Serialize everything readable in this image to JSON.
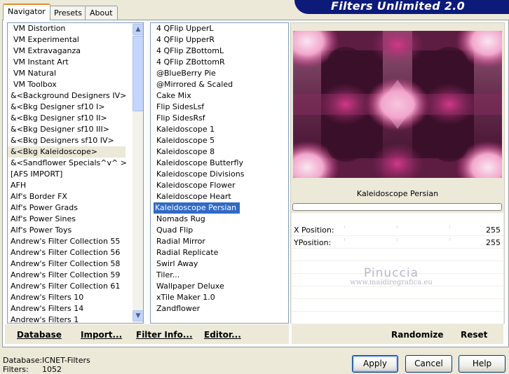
{
  "brand": {
    "title": "Filters Unlimited 2.0",
    "color": "#0c1a7a"
  },
  "tabs": [
    {
      "label": "Navigator",
      "active": true
    },
    {
      "label": "Presets",
      "active": false
    },
    {
      "label": "About",
      "active": false
    }
  ],
  "categories": {
    "items": [
      "VM Distortion",
      "VM Experimental",
      "VM Extravaganza",
      "VM Instant Art",
      "VM Natural",
      "VM Toolbox",
      "&<Background Designers IV>",
      "&<Bkg Designer sf10 I>",
      "&<Bkg Designer sf10 II>",
      "&<Bkg Designer sf10 III>",
      "&<Bkg Designers sf10 IV>",
      "&<Bkg Kaleidoscope>",
      "&<Sandflower Specials^v^ >",
      "[AFS IMPORT]",
      "AFH",
      "Alf's Border FX",
      "Alf's Power Grads",
      "Alf's Power Sines",
      "Alf's Power Toys",
      "Andrew's Filter Collection 55",
      "Andrew's Filter Collection 56",
      "Andrew's Filter Collection 58",
      "Andrew's Filter Collection 59",
      "Andrew's Filter Collection 61",
      "Andrew's Filters 10",
      "Andrew's Filters 14",
      "Andrew's Filters 1"
    ],
    "selected": "&<Bkg Kaleidoscope>"
  },
  "filters": {
    "items": [
      "4 QFlip UpperL",
      "4 QFlip UpperR",
      "4 QFlip ZBottomL",
      "4 QFlip ZBottomR",
      "@BlueBerry Pie",
      "@Mirrored & Scaled",
      "Cake Mix",
      "Flip SidesLsf",
      "Flip SidesRsf",
      "Kaleidoscope 1",
      "Kaleidoscope 5",
      "Kaleidoscope 8",
      "Kaleidoscope Butterfly",
      "Kaleidoscope Divisions",
      "Kaleidoscope Flower",
      "Kaleidoscope Heart",
      "Kaleidoscope Persian",
      "Nomads Rug",
      "Quad Flip",
      "Radial Mirror",
      "Radial Replicate",
      "Swirl Away",
      "Tiler...",
      "Wallpaper Deluxe",
      "xTile Maker 1.0",
      "Zandflower"
    ],
    "selected": "Kaleidoscope Persian"
  },
  "preview": {
    "filter_name": "Kaleidoscope Persian",
    "colors": [
      "#3a0f29",
      "#d4388a",
      "#f2a6cc",
      "#8a2c62",
      "#f9e6f0"
    ]
  },
  "params": [
    {
      "label": "X Position:",
      "value": "255"
    },
    {
      "label": "YPosition:",
      "value": "255"
    }
  ],
  "watermark": {
    "line1": "Pinuccia",
    "line2": "www.maidiregrafica.eu"
  },
  "left_commands": [
    "Database",
    "Import...",
    "Filter Info...",
    "Editor..."
  ],
  "right_commands": [
    "Randomize",
    "Reset"
  ],
  "status": {
    "database_label": "Database:",
    "database_value": "ICNET-Filters",
    "filters_label": "Filters:",
    "filters_value": "1052"
  },
  "buttons": {
    "apply": "Apply",
    "cancel": "Cancel",
    "help": "Help"
  }
}
